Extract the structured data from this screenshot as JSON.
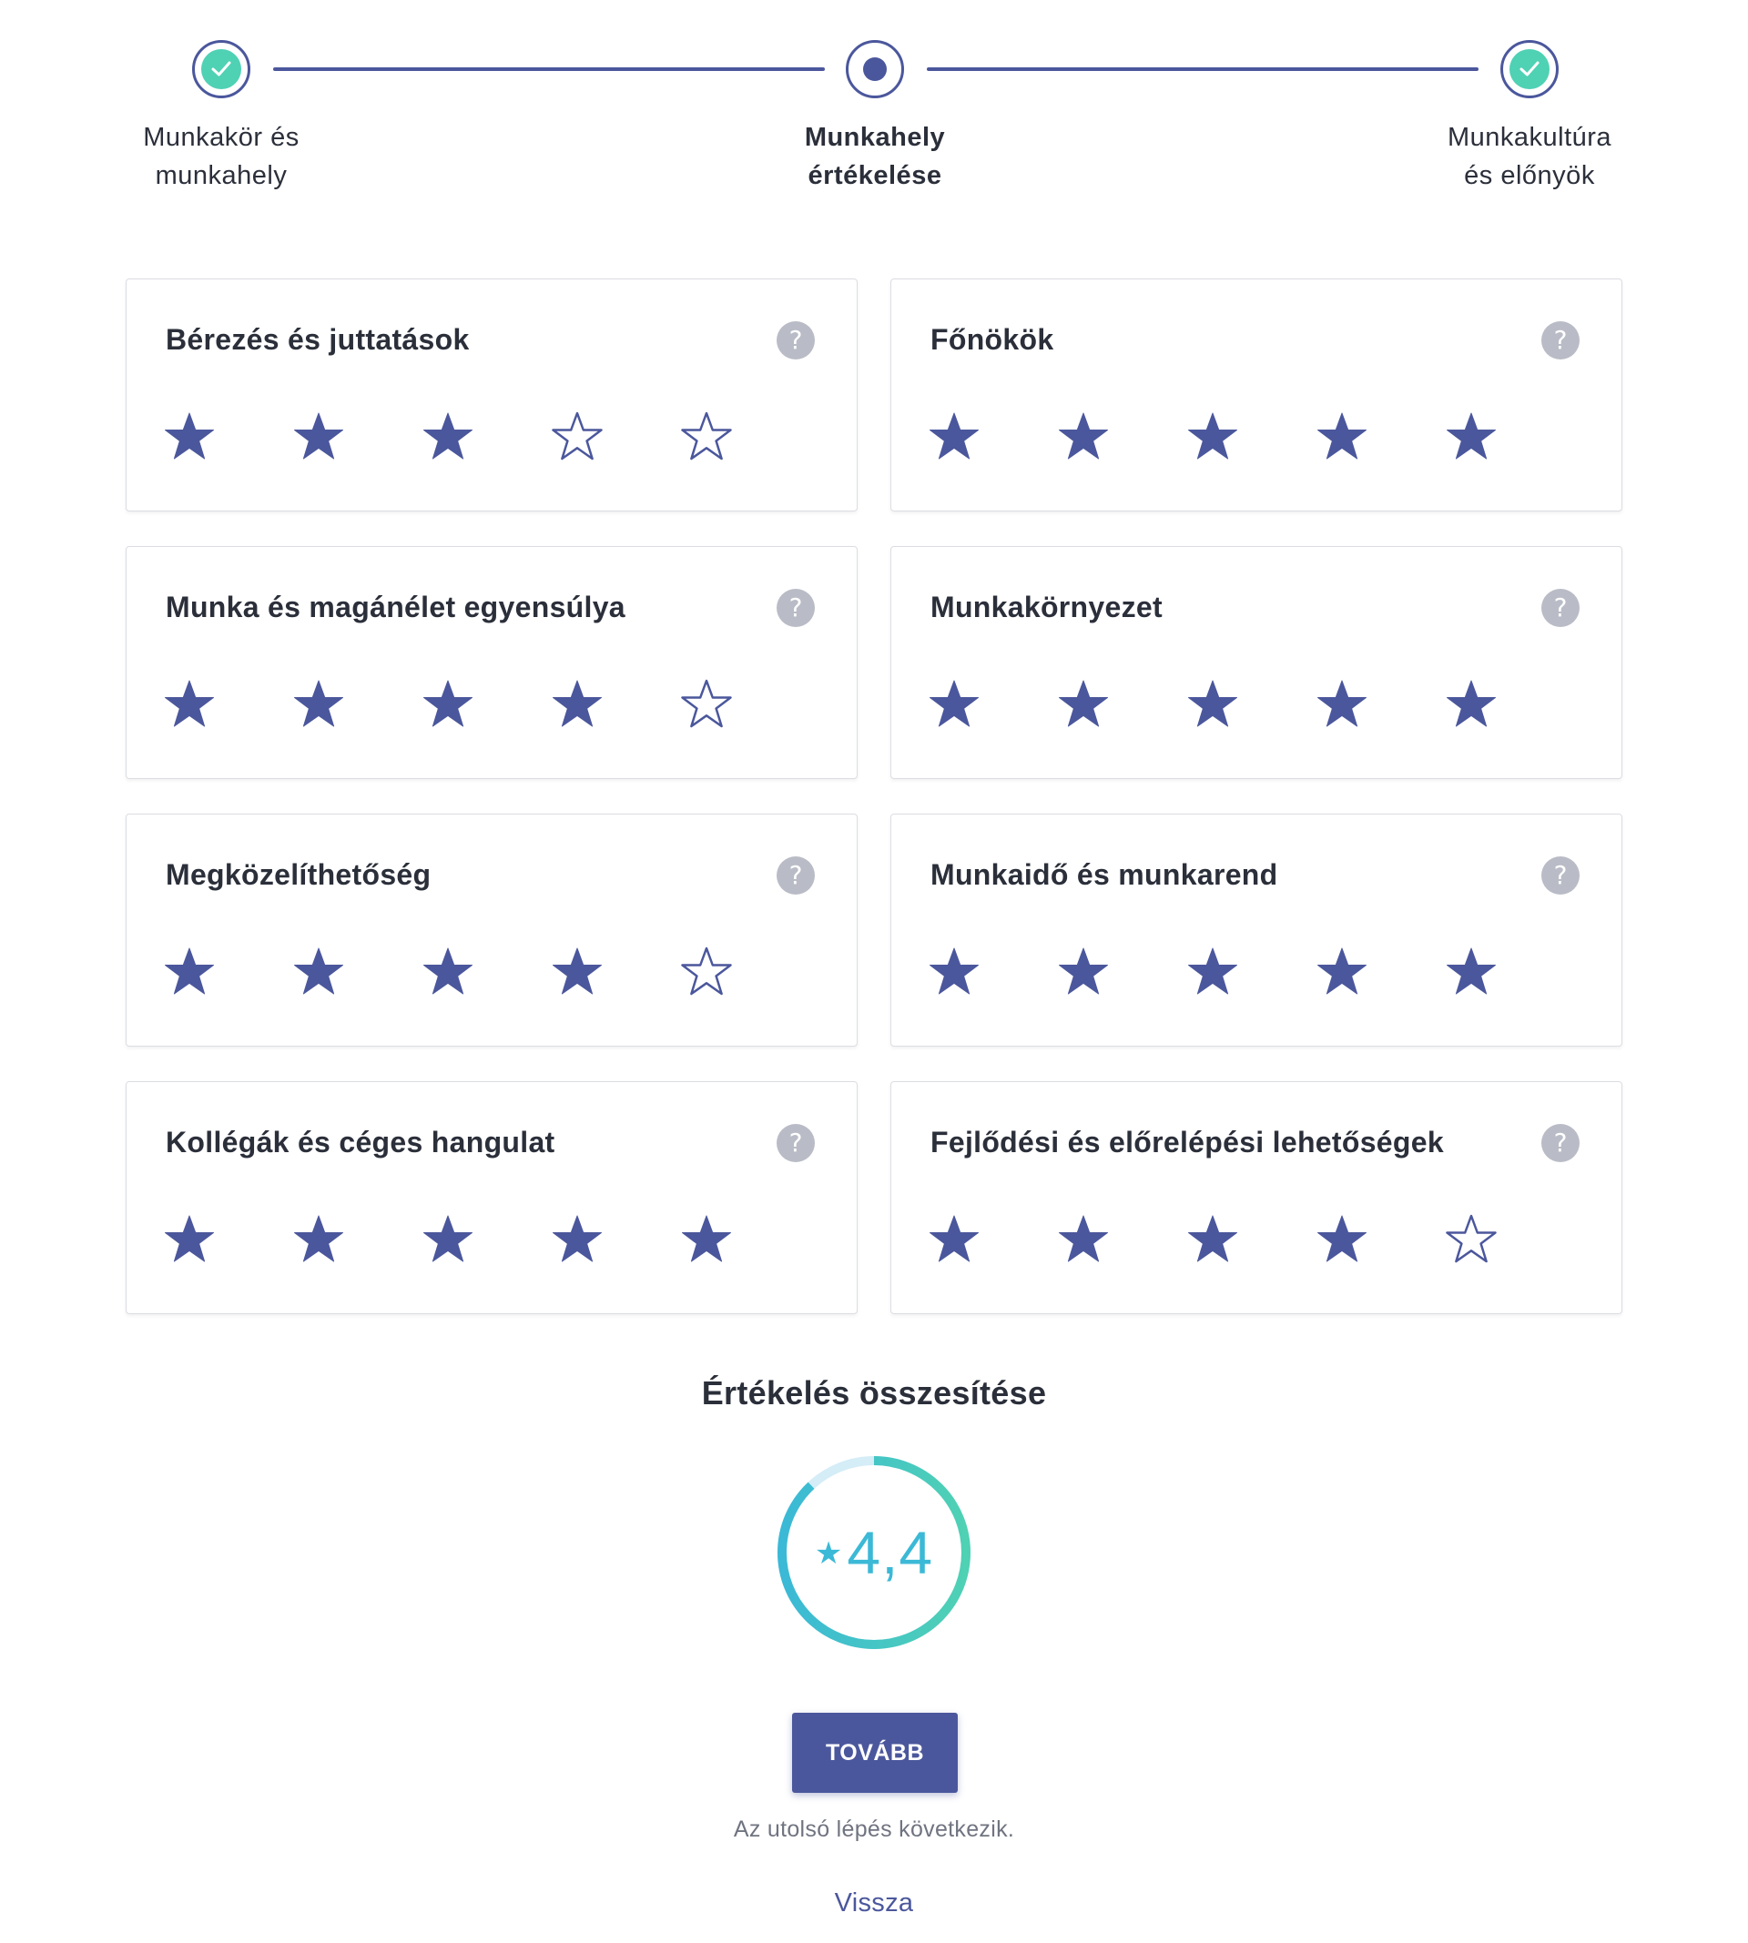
{
  "stepper": {
    "steps": [
      {
        "label_line1": "Munkakör és",
        "label_line2": "munkahely",
        "state": "completed",
        "icon": "check-icon"
      },
      {
        "label_line1": "Munkahely",
        "label_line2": "értékelése",
        "state": "active",
        "icon": "dot-icon"
      },
      {
        "label_line1": "Munkakultúra",
        "label_line2": "és előnyök",
        "state": "completed",
        "icon": "check-icon"
      }
    ]
  },
  "ratings": [
    {
      "title": "Bérezés és juttatások",
      "value": 3,
      "max": 5
    },
    {
      "title": "Főnökök",
      "value": 5,
      "max": 5
    },
    {
      "title": "Munka és magánélet egyensúlya",
      "value": 4,
      "max": 5
    },
    {
      "title": "Munkakörnyezet",
      "value": 5,
      "max": 5
    },
    {
      "title": "Megközelíthetőség",
      "value": 4,
      "max": 5
    },
    {
      "title": "Munkaidő és munkarend",
      "value": 5,
      "max": 5
    },
    {
      "title": "Kollégák és céges hangulat",
      "value": 5,
      "max": 5
    },
    {
      "title": "Fejlődési és előrelépési lehetőségek",
      "value": 4,
      "max": 5
    }
  ],
  "help_icon_text": "?",
  "summary": {
    "title": "Értékelés összesítése",
    "star_glyph": "★",
    "score": "4,4",
    "score_fraction": 0.88
  },
  "actions": {
    "next_label": "TOVÁBB",
    "hint": "Az utolsó lépés következik.",
    "back_label": "Vissza"
  },
  "colors": {
    "accent": "#4b579c",
    "success": "#4fd1b4",
    "gauge_start": "#3bb9d6",
    "gauge_end": "#4fd1b4",
    "gauge_track": "#d4edf7",
    "help_bg": "#b9bcc6"
  }
}
